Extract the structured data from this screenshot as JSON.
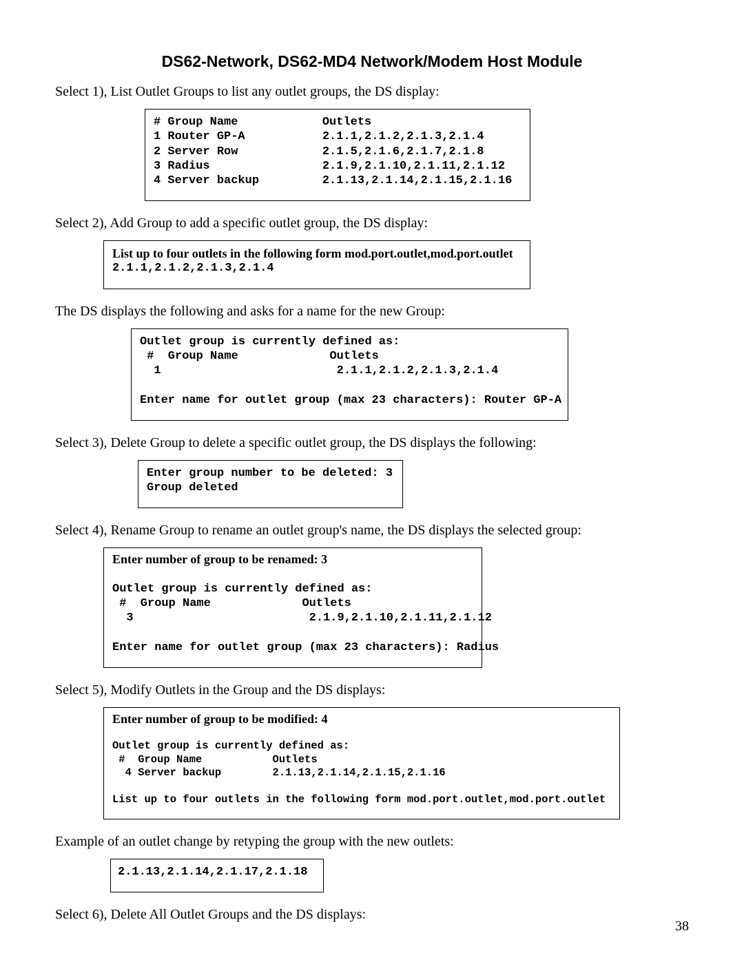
{
  "title": "DS62-Network, DS62-MD4 Network/Modem Host Module",
  "p1": "Select 1), List Outlet Groups to list any outlet groups, the DS display:",
  "box1": "# Group Name            Outlets\n1 Router GP-A           2.1.1,2.1.2,2.1.3,2.1.4\n2 Server Row            2.1.5,2.1.6,2.1.7,2.1.8\n3 Radius                2.1.9,2.1.10,2.1.11,2.1.12\n4 Server backup         2.1.13,2.1.14,2.1.15,2.1.16",
  "p2": "Select 2), Add Group to add a specific outlet group, the DS display:",
  "box2a": "List up to four outlets in the following form mod.port.outlet,mod.port.outlet",
  "box2b": "2.1.1,2.1.2,2.1.3,2.1.4",
  "p3": "The DS displays the following and asks for a name for the new Group:",
  "box3": "Outlet group is currently defined as:\n #  Group Name             Outlets\n  1                         2.1.1,2.1.2,2.1.3,2.1.4\n\nEnter name for outlet group (max 23 characters): Router GP-A",
  "p4": "Select 3), Delete Group to delete a specific outlet group, the DS displays the following:",
  "box4": "Enter group number to be deleted: 3\nGroup deleted",
  "p5": "Select 4), Rename Group to rename an outlet group's name, the DS displays the selected group:",
  "box5a": "Enter number of group to be renamed: 3",
  "box5b": "\nOutlet group is currently defined as:\n #  Group Name             Outlets\n  3                         2.1.9,2.1.10,2.1.11,2.1.12\n\nEnter name for outlet group (max 23 characters): Radius",
  "p6": "Select 5), Modify Outlets in the Group and the DS displays:",
  "box6a": "Enter number of group to be modified: 4",
  "box6b": "\nOutlet group is currently defined as:\n #  Group Name           Outlets\n  4 Server backup        2.1.13,2.1.14,2.1.15,2.1.16\n\nList up to four outlets in the following form mod.port.outlet,mod.port.outlet",
  "p7": "Example of an outlet change by retyping the group with the new outlets:",
  "box7": "2.1.13,2.1.14,2.1.17,2.1.18",
  "p8": "Select 6), Delete All Outlet Groups and the DS displays:",
  "page_number": "38"
}
